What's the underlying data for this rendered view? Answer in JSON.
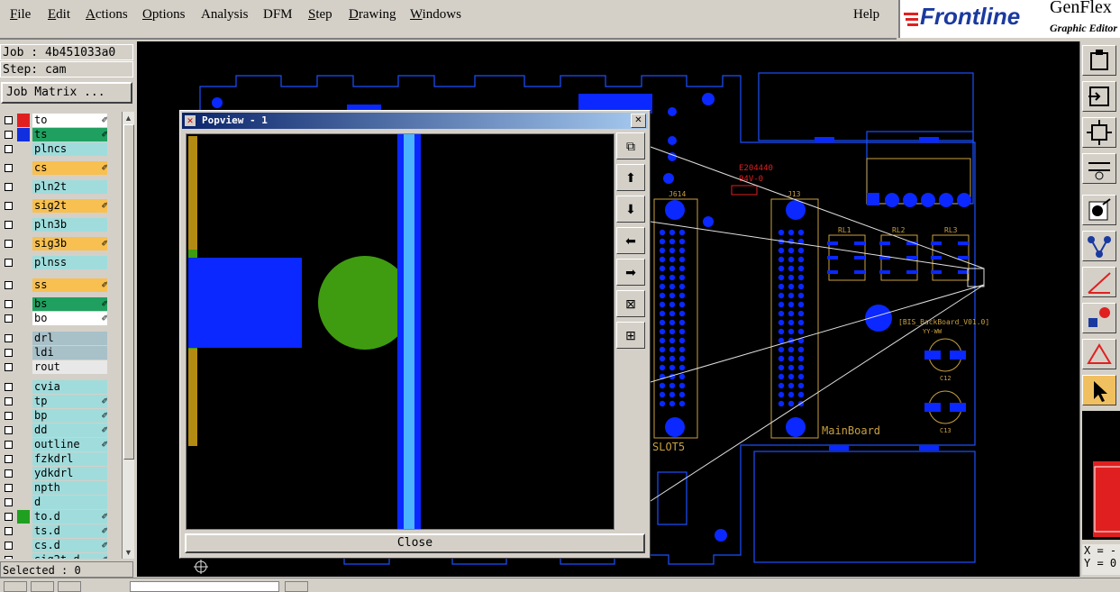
{
  "menubar": {
    "items": [
      {
        "label": "File",
        "ul": "F",
        "rest": "ile"
      },
      {
        "label": "Edit",
        "ul": "E",
        "rest": "dit"
      },
      {
        "label": "Actions",
        "ul": "A",
        "rest": "ctions"
      },
      {
        "label": "Options",
        "ul": "O",
        "rest": "ptions"
      },
      {
        "label": "Analysis",
        "ul": "",
        "rest": "Analysis"
      },
      {
        "label": "DFM",
        "ul": "",
        "rest": "DFM"
      },
      {
        "label": "Step",
        "ul": "S",
        "rest": "tep"
      },
      {
        "label": "Drawing",
        "ul": "D",
        "rest": "rawing"
      },
      {
        "label": "Windows",
        "ul": "W",
        "rest": "indows"
      }
    ],
    "help": "Help"
  },
  "brand": {
    "logo": "Frontline",
    "product": "GenFlex",
    "subtitle": "Graphic Editor"
  },
  "leftpanel": {
    "job": "Job : 4b451033a0",
    "step": "Step: cam",
    "job_matrix": "Job Matrix ...",
    "selected": "Selected : 0"
  },
  "layers": [
    {
      "name": "to",
      "color": "#ffffff",
      "swatch": "#e02020",
      "edit": true
    },
    {
      "name": "ts",
      "color": "#20a060",
      "swatch": "#1030e0",
      "edit": true
    },
    {
      "name": "plncs",
      "color": "#a0dcdc",
      "swatch": "",
      "edit": false
    },
    {
      "name": "cs",
      "color": "#f8c050",
      "swatch": "",
      "edit": true
    },
    {
      "name": "pln2t",
      "color": "#a0dcdc",
      "swatch": "",
      "edit": false
    },
    {
      "name": "sig2t",
      "color": "#f8c050",
      "swatch": "",
      "edit": true
    },
    {
      "name": "pln3b",
      "color": "#a0dcdc",
      "swatch": "",
      "edit": false
    },
    {
      "name": "sig3b",
      "color": "#f8c050",
      "swatch": "",
      "edit": true
    },
    {
      "name": "plnss",
      "color": "#a0dcdc",
      "swatch": "",
      "edit": false
    },
    {
      "name": "ss",
      "color": "#f8c050",
      "swatch": "",
      "edit": true
    },
    {
      "name": "bs",
      "color": "#20a060",
      "swatch": "",
      "edit": true
    },
    {
      "name": "bo",
      "color": "#ffffff",
      "swatch": "",
      "edit": true
    },
    {
      "name": "drl",
      "color": "#a8c0c8",
      "swatch": "",
      "edit": false
    },
    {
      "name": "ldi",
      "color": "#a8c0c8",
      "swatch": "",
      "edit": false
    },
    {
      "name": "rout",
      "color": "#e8e8e8",
      "swatch": "",
      "edit": false
    },
    {
      "name": "cvia",
      "color": "#a0dcdc",
      "swatch": "",
      "edit": false
    },
    {
      "name": "tp",
      "color": "#a0dcdc",
      "swatch": "",
      "edit": true
    },
    {
      "name": "bp",
      "color": "#a0dcdc",
      "swatch": "",
      "edit": true
    },
    {
      "name": "dd",
      "color": "#a0dcdc",
      "swatch": "",
      "edit": true
    },
    {
      "name": "outline",
      "color": "#a0dcdc",
      "swatch": "",
      "edit": true
    },
    {
      "name": "fzkdrl",
      "color": "#a0dcdc",
      "swatch": "",
      "edit": false
    },
    {
      "name": "ydkdrl",
      "color": "#a0dcdc",
      "swatch": "",
      "edit": false
    },
    {
      "name": "npth",
      "color": "#a0dcdc",
      "swatch": "",
      "edit": false
    },
    {
      "name": "d",
      "color": "#a0dcdc",
      "swatch": "",
      "edit": false
    },
    {
      "name": "to.d",
      "color": "#a0dcdc",
      "swatch": "#20a020",
      "edit": true
    },
    {
      "name": "ts.d",
      "color": "#a0dcdc",
      "swatch": "",
      "edit": true
    },
    {
      "name": "cs.d",
      "color": "#a0dcdc",
      "swatch": "",
      "edit": true
    },
    {
      "name": "sig2t.d",
      "color": "#a0dcdc",
      "swatch": "",
      "edit": true
    }
  ],
  "popview": {
    "title": "Popview - 1",
    "close_label": "Close",
    "tools": [
      "zoom-fit-icon",
      "pan-up-icon",
      "pan-down-icon",
      "pan-left-icon",
      "pan-right-icon",
      "zoom-out-icon",
      "zoom-in-icon"
    ]
  },
  "board": {
    "labels": {
      "e_label1": "E204440",
      "e_label2": "94V-0",
      "j614": "J614",
      "j13": "J13",
      "rl1": "RL1",
      "rl2": "RL2",
      "rl3": "RL3",
      "bis": "[BIS_BackBoard_V01.0]",
      "yy": "YY-WW",
      "c12": "C12",
      "c13": "C13",
      "mainboard": "MainBoard",
      "slot5": "SLOT5"
    }
  },
  "righttools": {
    "icons": [
      "clipboard-icon",
      "import-icon",
      "fit-icon",
      "measure-icon",
      "draw-pad-icon",
      "net-icon",
      "line-icon",
      "feature-icon",
      "triangle-icon",
      "pointer-icon"
    ],
    "coords": {
      "x": "X = -",
      "y": "Y = 0"
    }
  },
  "colors": {
    "canvas": "#000000",
    "copper": "#0a28ff",
    "board_outline": "#1a4fff",
    "silk": "#c8a040",
    "highlight": "#4cb3ff",
    "pad_green": "#3f9c10"
  }
}
